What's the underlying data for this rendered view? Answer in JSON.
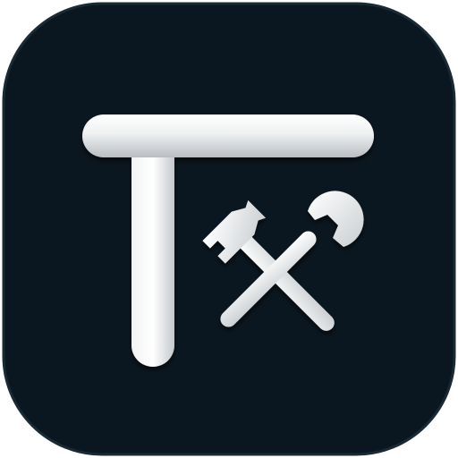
{
  "app_icon": {
    "icon_name": "textsoap-tools-icon",
    "glyph_icon": "letter-t-icon",
    "tools_icon": "hammer-and-wrench-icon",
    "colors": {
      "background": "#0b1720",
      "background_edge": "#1a2a35",
      "glyph_light": "#f6f7f7",
      "glyph_mid": "#d9dcde",
      "glyph_shadow": "#9aa1a6"
    }
  }
}
